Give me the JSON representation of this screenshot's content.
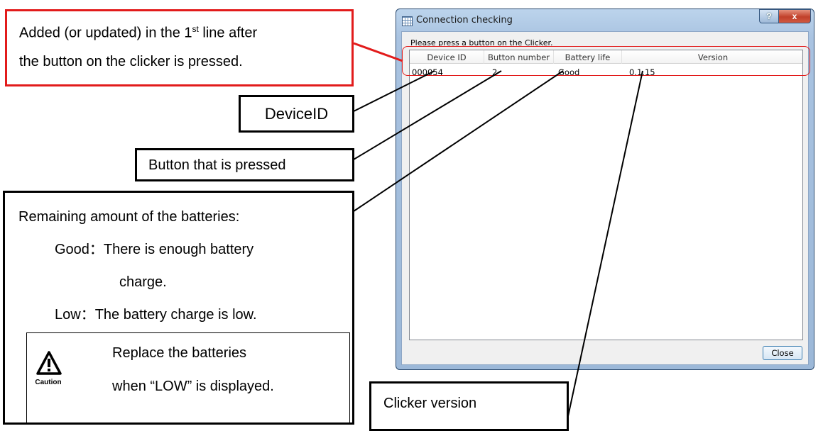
{
  "window": {
    "title": "Connection checking",
    "help_label": "?",
    "close_label": "x",
    "instruction": "Please press a button on the Clicker.",
    "columns": [
      "Device ID",
      "Button number",
      "Battery life",
      "Version"
    ],
    "rows": [
      {
        "device_id": "000054",
        "button_number": "2",
        "battery_life": "Good",
        "version": "0.1.15"
      }
    ],
    "close_button": "Close"
  },
  "callouts": {
    "added_line1_pre": "Added (or updated) in the 1",
    "added_line1_sup": "st",
    "added_line1_post": " line after",
    "added_line2": "the button on the clicker is pressed.",
    "device_id": "DeviceID",
    "button_pressed": "Button that is pressed",
    "battery_title": "Remaining amount of the batteries:",
    "battery_good_1": "Good：There is enough battery",
    "battery_good_2": "charge.",
    "battery_low": "Low：The battery charge is low.",
    "caution_label": "Caution",
    "caution_line1": "Replace the batteries",
    "caution_line2": "when “LOW” is displayed.",
    "clicker_version": "Clicker version"
  },
  "colors": {
    "annotation_red": "#e21b1b",
    "window_frame": "#a9c3e1"
  }
}
